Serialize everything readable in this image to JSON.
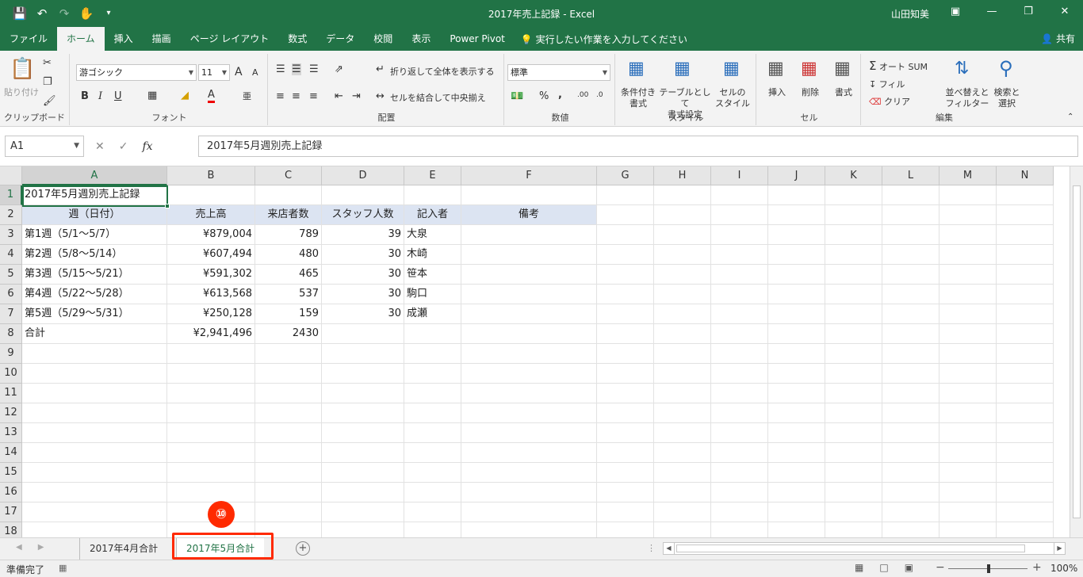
{
  "window": {
    "title": "2017年売上記録  -  Excel",
    "user": "山田知美"
  },
  "qat": {
    "save_icon": "save-icon",
    "undo_icon": "undo-icon",
    "redo_icon": "redo-icon",
    "touch_icon": "touch-mode-icon"
  },
  "ribbon_tabs": [
    "ファイル",
    "ホーム",
    "挿入",
    "描画",
    "ページ レイアウト",
    "数式",
    "データ",
    "校閲",
    "表示",
    "Power Pivot"
  ],
  "active_tab": "ホーム",
  "tell_me": "実行したい作業を入力してください",
  "share": "共有",
  "ribbon": {
    "clipboard": {
      "paste": "貼り付け",
      "label": "クリップボード"
    },
    "font": {
      "name": "游ゴシック",
      "size": "11",
      "bold": "B",
      "italic": "I",
      "underline": "U",
      "grow": "A",
      "shrink": "A",
      "color": "A",
      "label": "フォント"
    },
    "alignment": {
      "wrap": "折り返して全体を表示する",
      "merge": "セルを結合して中央揃え",
      "label": "配置"
    },
    "number": {
      "format": "標準",
      "percent": "%",
      "comma": ",",
      "inc": ".00",
      "dec": ".0",
      "label": "数値"
    },
    "styles": {
      "conditional": "条件付き",
      "conditional2": "書式",
      "table": "テーブルとして",
      "table2": "書式設定",
      "cell": "セルの",
      "cell2": "スタイル",
      "label": "スタイル"
    },
    "cells": {
      "insert": "挿入",
      "delete": "削除",
      "format": "書式",
      "label": "セル"
    },
    "editing": {
      "autosum": "オート SUM",
      "fill": "フィル",
      "clear": "クリア",
      "sort": "並べ替えと",
      "sort2": "フィルター",
      "find": "検索と",
      "find2": "選択",
      "label": "編集"
    }
  },
  "formula_bar": {
    "name_box": "A1",
    "content": "2017年5月週別売上記録"
  },
  "columns": [
    "A",
    "B",
    "C",
    "D",
    "E",
    "F",
    "G",
    "H",
    "I",
    "J",
    "K",
    "L",
    "M",
    "N"
  ],
  "rows": [
    "1",
    "2",
    "3",
    "4",
    "5",
    "6",
    "7",
    "8",
    "9",
    "10",
    "11",
    "12",
    "13",
    "14",
    "15",
    "16",
    "17",
    "18"
  ],
  "cells": {
    "A1": "2017年5月週別売上記録",
    "header": [
      "週（日付）",
      "売上高",
      "来店者数",
      "スタッフ人数",
      "記入者",
      "備考"
    ],
    "data": [
      [
        "第1週（5/1～5/7）",
        "¥879,004",
        "789",
        "39",
        "大泉"
      ],
      [
        "第2週（5/8～5/14）",
        "¥607,494",
        "480",
        "30",
        "木崎"
      ],
      [
        "第3週（5/15～5/21）",
        "¥591,302",
        "465",
        "30",
        "笹本"
      ],
      [
        "第4週（5/22～5/28）",
        "¥613,568",
        "537",
        "30",
        "駒口"
      ],
      [
        "第5週（5/29～5/31）",
        "¥250,128",
        "159",
        "30",
        "成瀬"
      ]
    ],
    "total": [
      "合計",
      "¥2,941,496",
      "2430"
    ]
  },
  "sheets": [
    "2017年4月合計",
    "2017年5月合計"
  ],
  "active_sheet": "2017年5月合計",
  "annotation_marker": "⑩",
  "status": {
    "ready": "準備完了",
    "zoom": "100%"
  },
  "colors": {
    "excel_green": "#217346",
    "highlight_red": "#ff2a00",
    "header_fill": "#dce4f2"
  }
}
